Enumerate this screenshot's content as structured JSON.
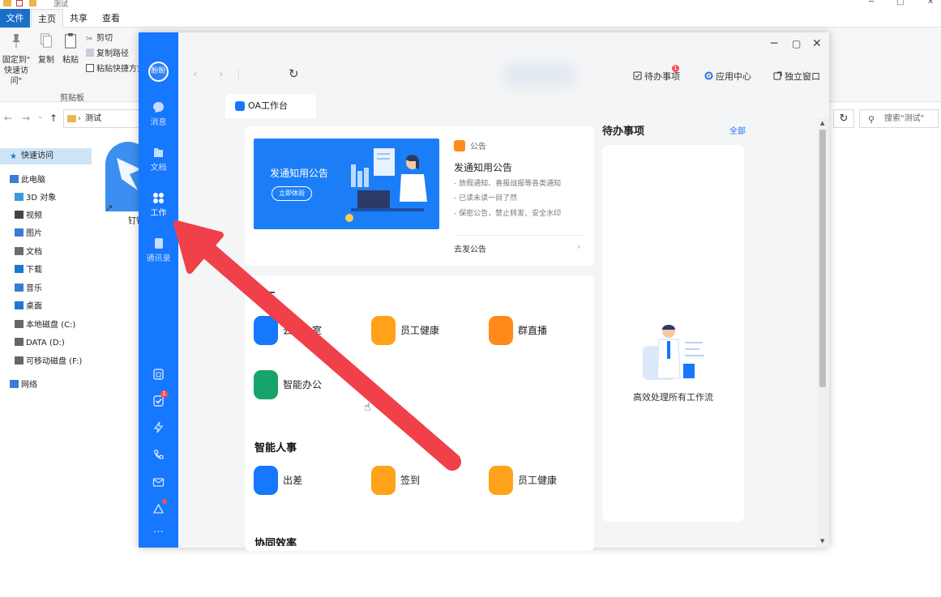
{
  "explorer": {
    "title": "测试",
    "tabs": {
      "file": "文件",
      "home": "主页",
      "share": "共享",
      "view": "查看"
    },
    "ribbon": {
      "pin_line1": "固定到\"",
      "pin_line2": "快速访问\"",
      "copy": "复制",
      "paste": "粘贴",
      "cut": "剪切",
      "copy_path": "复制路径",
      "paste_shortcut": "粘贴快捷方式",
      "group_clipboard": "剪贴板"
    },
    "address": {
      "folder": "测试"
    },
    "search_placeholder": "搜索\"测试\"",
    "nav": [
      {
        "label": "快速访问",
        "icon": "star-icon"
      },
      {
        "label": "此电脑",
        "icon": "computer-icon"
      },
      {
        "label": "3D 对象",
        "icon": "cube-icon"
      },
      {
        "label": "视频",
        "icon": "video-icon"
      },
      {
        "label": "图片",
        "icon": "picture-icon"
      },
      {
        "label": "文档",
        "icon": "document-icon"
      },
      {
        "label": "下载",
        "icon": "download-icon"
      },
      {
        "label": "音乐",
        "icon": "music-icon"
      },
      {
        "label": "桌面",
        "icon": "desktop-icon"
      },
      {
        "label": "本地磁盘 (C:)",
        "icon": "disk-icon"
      },
      {
        "label": "DATA (D:)",
        "icon": "disk-icon"
      },
      {
        "label": "可移动磁盘 (F:)",
        "icon": "usb-disk-icon"
      },
      {
        "label": "网络",
        "icon": "network-icon"
      }
    ],
    "desktop_icon_label": "钉钉"
  },
  "dingtalk": {
    "avatar": "盼盼",
    "sidebar": [
      {
        "label": "消息",
        "icon": "message-icon"
      },
      {
        "label": "文档",
        "icon": "docs-icon"
      },
      {
        "label": "工作",
        "icon": "work-grid-icon"
      },
      {
        "label": "通讯录",
        "icon": "contacts-icon"
      }
    ],
    "sidebar_bottom_badge": "1",
    "toolbar": {
      "todo": "待办事项",
      "todo_badge": "1",
      "app_center": "应用中心",
      "standalone": "独立窗口"
    },
    "tab": "OA工作台",
    "banner": {
      "title": "发通知用公告",
      "button": "立即体验"
    },
    "announcement": {
      "tag": "公告",
      "title": "发通知用公告",
      "lines": [
        "- 放假通知、喜报战报等各类通知",
        "- 已读未读一目了然",
        "- 保密公告，禁止转发、安全水印"
      ],
      "link": "去发公告"
    },
    "sections": [
      {
        "title": "复工",
        "apps": [
          {
            "label": "云办公室",
            "color": "#1677ff"
          },
          {
            "label": "员工健康",
            "color": "#ffa21a"
          },
          {
            "label": "群直播",
            "color": "#ff8a1a"
          },
          {
            "label": "智能办公",
            "color": "#16a46b"
          }
        ]
      },
      {
        "title": "智能人事",
        "apps": [
          {
            "label": "出差",
            "color": "#1677ff"
          },
          {
            "label": "签到",
            "color": "#ffa21a"
          },
          {
            "label": "员工健康",
            "color": "#ffa21a"
          }
        ]
      },
      {
        "title": "协同效率"
      }
    ],
    "todo": {
      "title": "待办事项",
      "all": "全部",
      "empty_text": "高效处理所有工作流"
    },
    "accent": "#1677ff"
  },
  "overlay": {
    "arrow_color": "#f0404a"
  }
}
